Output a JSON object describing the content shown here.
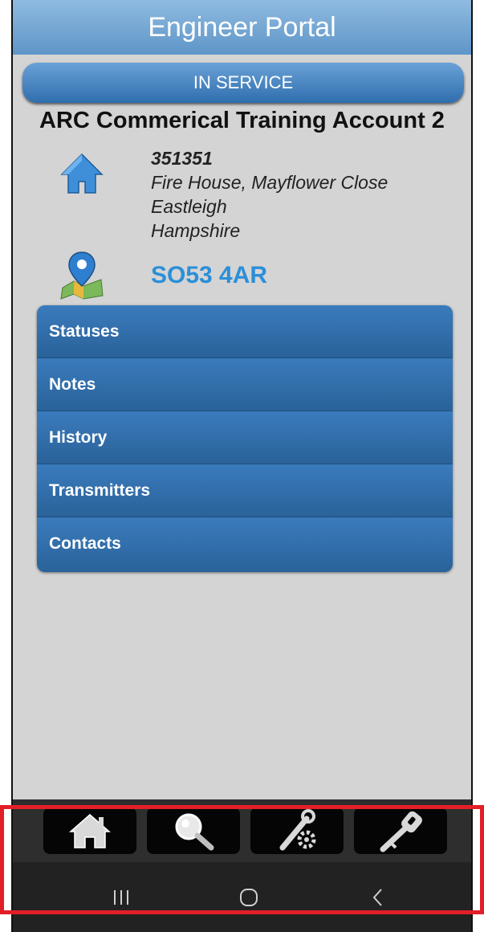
{
  "header": {
    "title": "Engineer Portal"
  },
  "status": {
    "label": "IN SERVICE"
  },
  "account": {
    "name": "ARC Commerical Training Account 2",
    "number": "351351",
    "address_lines": [
      "Fire House, Mayflower Close",
      "Eastleigh",
      "Hampshire"
    ],
    "postcode": "SO53 4AR"
  },
  "menu": {
    "items": [
      {
        "label": "Statuses"
      },
      {
        "label": "Notes"
      },
      {
        "label": "History"
      },
      {
        "label": "Transmitters"
      },
      {
        "label": "Contacts"
      }
    ]
  },
  "navbar": {
    "buttons": [
      {
        "icon": "home-icon"
      },
      {
        "icon": "search-icon"
      },
      {
        "icon": "tools-icon"
      },
      {
        "icon": "key-icon"
      }
    ]
  },
  "android_nav": {
    "buttons": [
      {
        "icon": "recent-apps-icon"
      },
      {
        "icon": "home-circle-icon"
      },
      {
        "icon": "back-icon"
      }
    ]
  },
  "colors": {
    "accent": "#2b8fd8",
    "menu_blue": "#2f6ea8",
    "highlight": "#e21f27"
  }
}
